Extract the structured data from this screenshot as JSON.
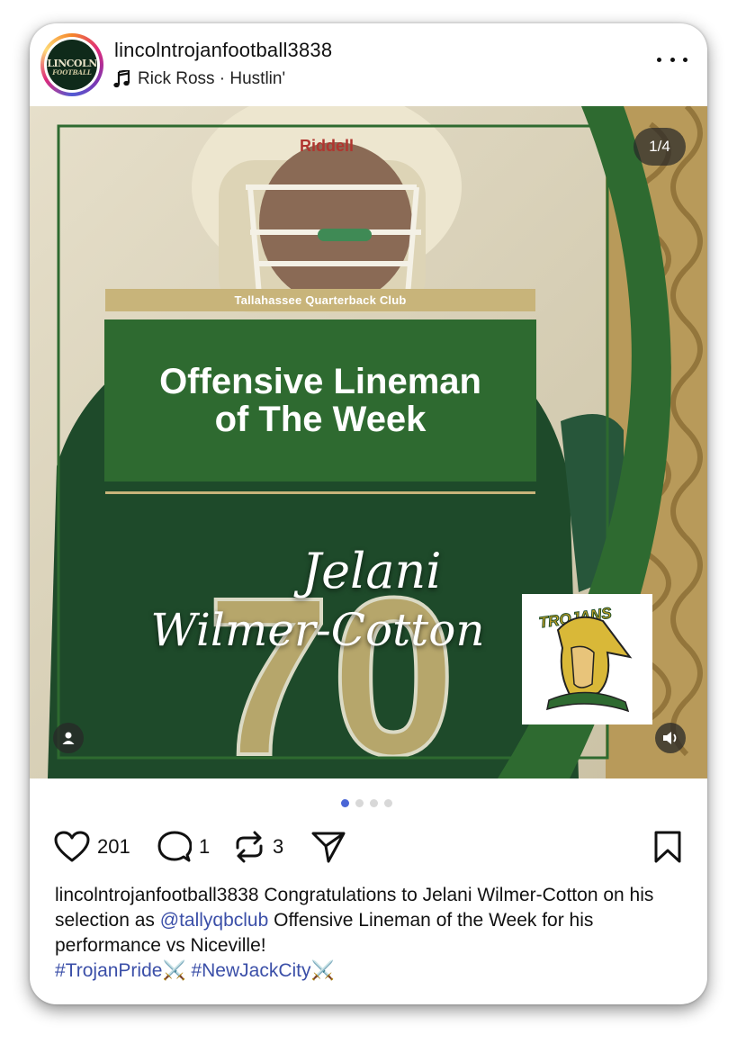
{
  "header": {
    "username": "lincolntrojanfootball3838",
    "avatar_text_1": "LINCOLN",
    "avatar_text_2": "FOOTBALL",
    "music": "Rick Ross · Hustlin'",
    "music_icon": "music-note-icon",
    "more_icon": "more-dots-icon"
  },
  "media": {
    "counter": "1/4",
    "club": "Tallahassee Quarterback Club",
    "title_line1": "Offensive Lineman",
    "title_line2": "of The Week",
    "name_line1": "Jelani",
    "name_line2": "Wilmer-Cotton",
    "helmet_brand": "Riddell",
    "jersey_number": "70",
    "logo_text": "TROJANS",
    "user_tag_icon": "person-icon",
    "audio_icon": "speaker-icon",
    "colors": {
      "green": "#2e6a30",
      "gold": "#c8b47a"
    }
  },
  "carousel": {
    "total": 4,
    "active": 1
  },
  "actions": {
    "likes": "201",
    "comments": "1",
    "reposts": "3",
    "like_icon": "heart-icon",
    "comment_icon": "comment-bubble-icon",
    "repost_icon": "repost-icon",
    "share_icon": "send-icon",
    "save_icon": "bookmark-icon"
  },
  "caption": {
    "username": "lincolntrojanfootball3838",
    "text_1": "Congratulations to Jelani Wilmer-Cotton on his selection as",
    "mention": "@tallyqbclub",
    "text_2": "Offensive Lineman of the Week for his performance vs Niceville!",
    "hashtag_1": "#TrojanPride",
    "emoji_1": "⚔️",
    "hashtag_2": "#NewJackCity",
    "emoji_2": "⚔️"
  }
}
